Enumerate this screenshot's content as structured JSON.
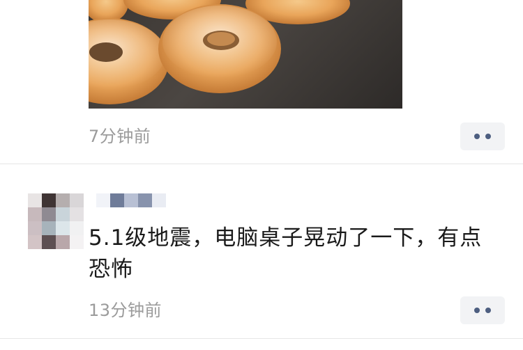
{
  "feed": {
    "post": {
      "timestamp": "7分钟前"
    },
    "comment": {
      "text": "5.1级地震，电脑桌子晃动了一下，有点恐怖",
      "timestamp": "13分钟前"
    }
  },
  "colors": {
    "timestamp": "#9b9b9b",
    "more_button_bg": "#f2f3f5",
    "more_button_dots": "#4d5e80",
    "divider": "#e6e6e6",
    "comment_text": "#1a1a1a"
  }
}
